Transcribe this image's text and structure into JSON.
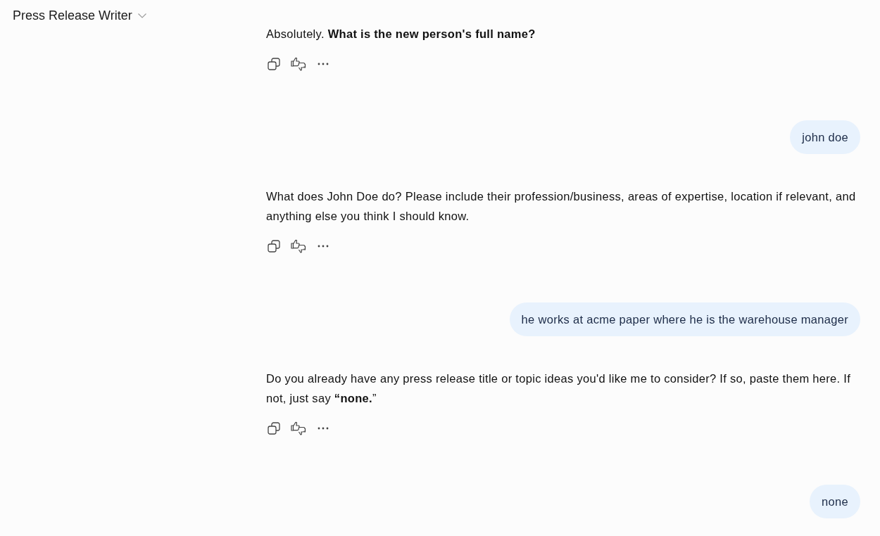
{
  "header": {
    "title": "Press Release Writer"
  },
  "messages": [
    {
      "kind": "assistant",
      "text": "Absolutely. **What is the new person's full name?**"
    },
    {
      "kind": "user",
      "text": "john doe"
    },
    {
      "kind": "assistant",
      "text": "What does John Doe do? Please include their profession/business, areas of expertise, location if relevant, and anything else you think I should know."
    },
    {
      "kind": "user",
      "text": "he works at acme paper where he is the warehouse manager"
    },
    {
      "kind": "assistant",
      "text": "Do you already have any press release title or topic ideas you'd like me to consider? If so, paste them here. If not, just say **“none.**”"
    },
    {
      "kind": "user",
      "text": "none"
    }
  ]
}
